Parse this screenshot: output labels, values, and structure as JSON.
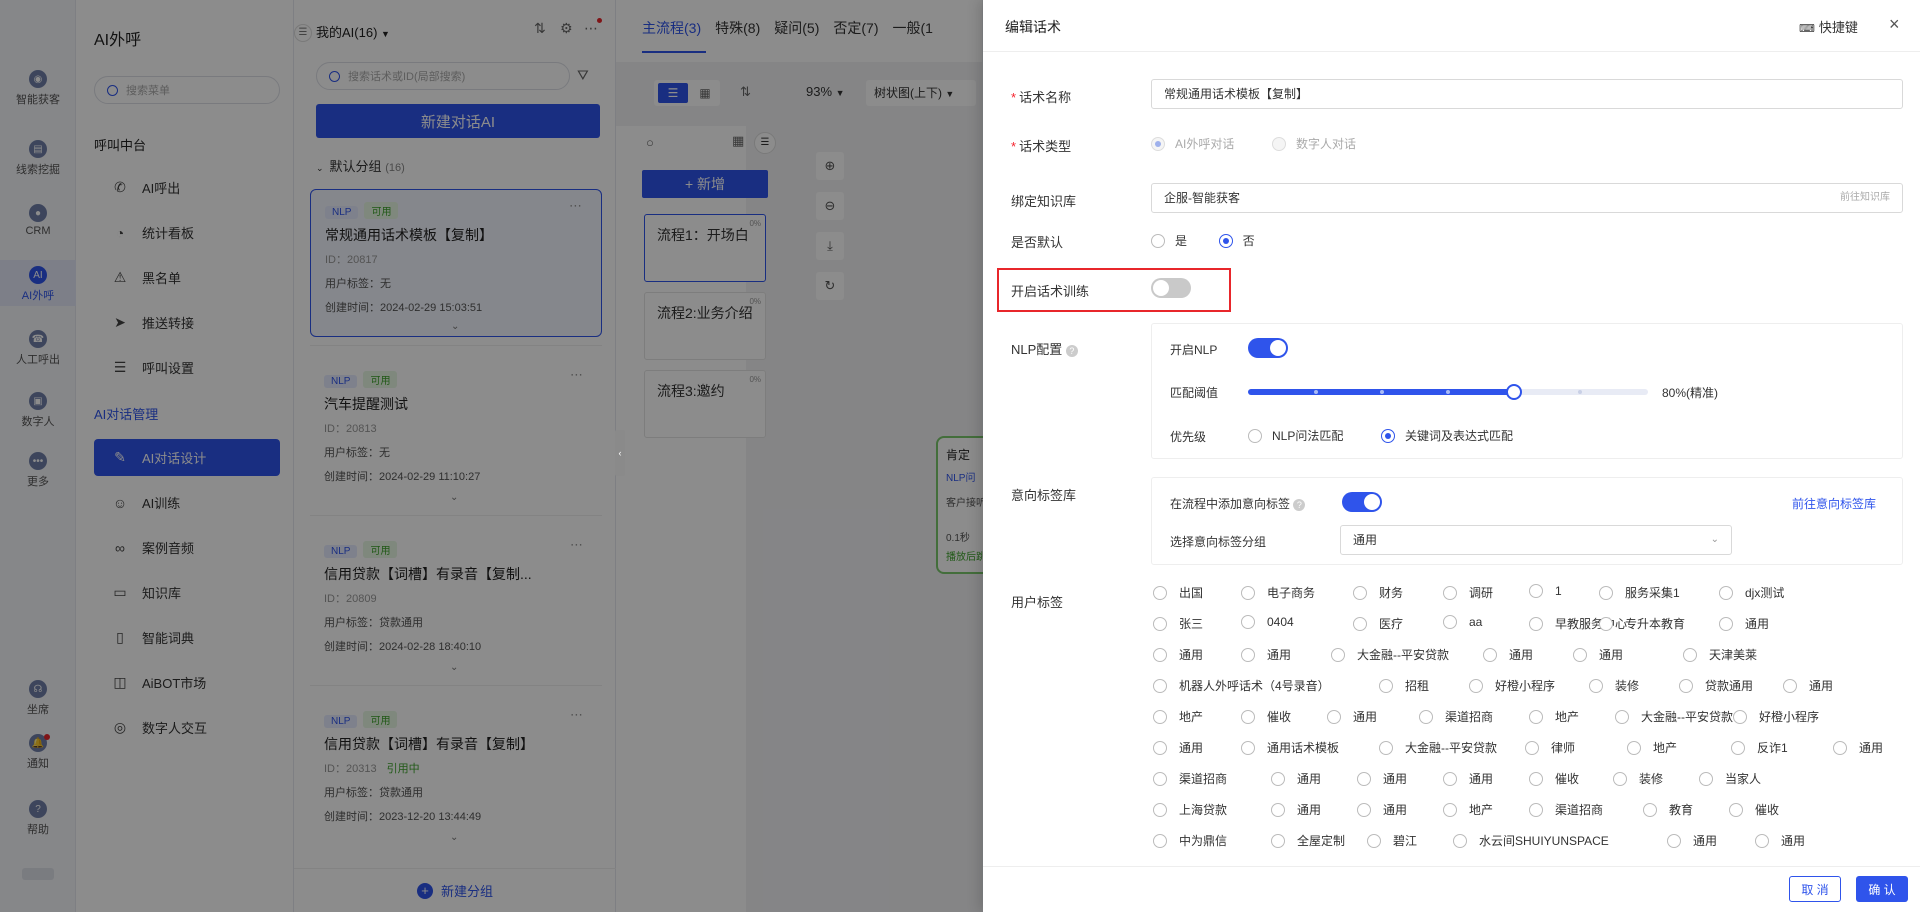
{
  "rail": [
    {
      "label": "智能获客",
      "glyph": "◉",
      "icon": "target-icon"
    },
    {
      "label": "线索挖掘",
      "glyph": "▤",
      "icon": "clue-icon"
    },
    {
      "label": "CRM",
      "glyph": "●",
      "icon": "crm-icon"
    },
    {
      "label": "AI外呼",
      "glyph": "AI",
      "icon": "ai-call-icon",
      "active": true
    },
    {
      "label": "人工呼出",
      "glyph": "☎",
      "icon": "manual-call-icon"
    },
    {
      "label": "数字人",
      "glyph": "▣",
      "icon": "digital-human-icon"
    },
    {
      "label": "更多",
      "glyph": "•••",
      "icon": "more-icon"
    },
    {
      "label": "坐席",
      "glyph": "☊",
      "icon": "headset-icon"
    },
    {
      "label": "通知",
      "glyph": "🔔",
      "icon": "bell-icon"
    },
    {
      "label": "帮助",
      "glyph": "?",
      "icon": "help-icon"
    }
  ],
  "menu": {
    "title": "AI外呼",
    "search_placeholder": "搜索菜单",
    "section1": "呼叫中台",
    "items1": [
      {
        "label": "AI呼出",
        "glyph": "✆",
        "icon": "phone-icon"
      },
      {
        "label": "统计看板",
        "glyph": "◔",
        "icon": "chart-icon"
      },
      {
        "label": "黑名单",
        "glyph": "⚠",
        "icon": "warning-icon"
      },
      {
        "label": "推送转接",
        "glyph": "➤",
        "icon": "send-icon"
      },
      {
        "label": "呼叫设置",
        "glyph": "☰",
        "icon": "settings-sliders-icon"
      }
    ],
    "section2": "AI对话管理",
    "items2": [
      {
        "label": "AI对话设计",
        "glyph": "✎",
        "icon": "edit-icon",
        "active": true
      },
      {
        "label": "AI训练",
        "glyph": "☺",
        "icon": "training-icon"
      },
      {
        "label": "案例音频",
        "glyph": "∞",
        "icon": "audio-icon"
      },
      {
        "label": "知识库",
        "glyph": "▭",
        "icon": "monitor-icon"
      },
      {
        "label": "智能词典",
        "glyph": "▯",
        "icon": "book-icon"
      },
      {
        "label": "AiBOT市场",
        "glyph": "◫",
        "icon": "market-icon"
      },
      {
        "label": "数字人交互",
        "glyph": "◎",
        "icon": "digital-interact-icon"
      }
    ]
  },
  "list": {
    "header": "我的AI(16)",
    "search_placeholder": "搜索话术或ID(局部搜索)",
    "new_button": "新建对话AI",
    "group": "默认分组",
    "group_count": "(16)",
    "new_group": "新建分组",
    "cards": [
      {
        "tag1": "NLP",
        "tag2": "可用",
        "title": "常规通用话术模板【复制】",
        "id": "ID：20817",
        "status": "",
        "user_tag": "用户标签：无",
        "created": "创建时间：2024-02-29 15:03:51"
      },
      {
        "tag1": "NLP",
        "tag2": "可用",
        "title": "汽车提醒测试",
        "id": "ID：20813",
        "status": "",
        "user_tag": "用户标签：无",
        "created": "创建时间：2024-02-29 11:10:27"
      },
      {
        "tag1": "NLP",
        "tag2": "可用",
        "title": "信用贷款【词槽】有录音【复制...",
        "id": "ID：20809",
        "status": "",
        "user_tag": "用户标签：贷款通用",
        "created": "创建时间：2024-02-28 18:40:10"
      },
      {
        "tag1": "NLP",
        "tag2": "可用",
        "title": "信用贷款【词槽】有录音【复制】",
        "id": "ID：20313",
        "status": "引用中",
        "user_tag": "用户标签：贷款通用",
        "created": "创建时间：2023-12-20 13:44:49"
      }
    ]
  },
  "flow": {
    "tabs": [
      "主流程(3)",
      "特殊(8)",
      "疑问(5)",
      "否定(7)",
      "一般(1"
    ],
    "zoom": "93%",
    "view": "树状图(上下)",
    "add_button": "+ 新增",
    "steps": [
      {
        "label": "流程1：开场白",
        "pct": "0%"
      },
      {
        "label": "流程2:业务介绍",
        "pct": "0%"
      },
      {
        "label": "流程3:邀约",
        "pct": "0%"
      }
    ],
    "node": {
      "title": "肯定",
      "line1": "NLP问",
      "line2": "客户接听",
      "line3": "0.1秒",
      "line4": "播放后跳"
    }
  },
  "drawer": {
    "title": "编辑话术",
    "shortcut": "快捷键",
    "name_label": "话术名称",
    "name_value": "常规通用话术模板【复制】",
    "type_label": "话术类型",
    "type_opt1": "AI外呼对话",
    "type_opt2": "数字人对话",
    "kb_label": "绑定知识库",
    "kb_value": "企服-智能获客",
    "kb_link": "前往知识库",
    "default_label": "是否默认",
    "default_yes": "是",
    "default_no": "否",
    "train_label": "开启话术训练",
    "nlp_label": "NLP配置",
    "nlp_enable": "开启NLP",
    "threshold_label": "匹配阈值",
    "threshold_value": 0.8,
    "threshold_text": "80%(精准)",
    "priority_label": "优先级",
    "priority_opt1": "NLP问法匹配",
    "priority_opt2": "关键词及表达式匹配",
    "intent_label": "意向标签库",
    "intent_add": "在流程中添加意向标签",
    "intent_link": "前往意向标签库",
    "intent_group_label": "选择意向标签分组",
    "intent_group_value": "通用",
    "user_tag_label": "用户标签",
    "user_tags": [
      [
        "出国",
        "电子商务",
        "财务",
        "调研",
        "1",
        "服务采集1",
        "djx测试"
      ],
      [
        "张三",
        "0404",
        "医疗",
        "aa",
        "早教服务中心",
        "专升本教育",
        "通用"
      ],
      [
        "通用",
        "通用",
        "大金融--平安贷款",
        "通用",
        "通用",
        "天津美莱"
      ],
      [
        "机器人外呼话术（4号录音）",
        "招租",
        "好橙小程序",
        "装修",
        "贷款通用",
        "通用"
      ],
      [
        "地产",
        "催收",
        "通用",
        "渠道招商",
        "地产",
        "大金融--平安贷款",
        "好橙小程序"
      ],
      [
        "通用",
        "通用话术模板",
        "大金融--平安贷款",
        "律师",
        "地产",
        "反诈1",
        "通用"
      ],
      [
        "渠道招商",
        "通用",
        "通用",
        "通用",
        "催收",
        "装修",
        "当家人"
      ],
      [
        "上海贷款",
        "通用",
        "通用",
        "地产",
        "渠道招商",
        "教育",
        "催收"
      ],
      [
        "中为鼎信",
        "全屋定制",
        "碧江",
        "水云间SHUIYUNSPACE",
        "通用",
        "通用"
      ]
    ],
    "cancel": "取 消",
    "confirm": "确 认"
  },
  "colors": {
    "accent": "#2f54eb",
    "highlight_border": "#e8262b",
    "success": "#3ca32a"
  }
}
